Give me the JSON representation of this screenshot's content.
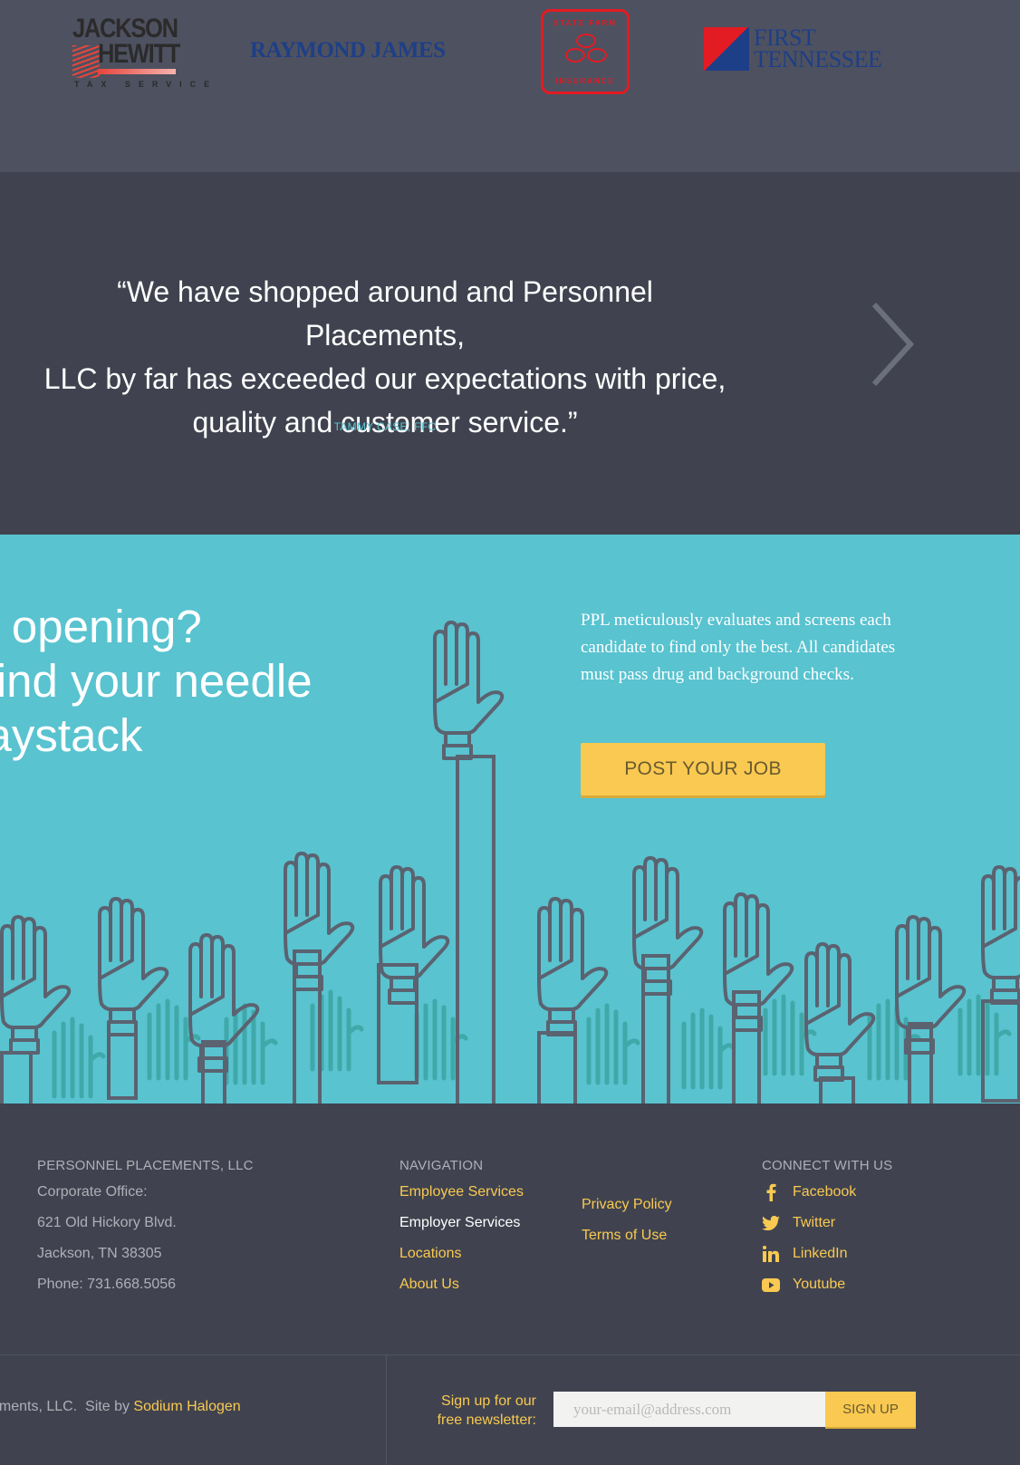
{
  "logos": {
    "jackson_hewitt": {
      "line1": "JACKSON",
      "line2": "HEWITT",
      "tagline": "TAX SERVICE"
    },
    "raymond_james": "RAYMOND JAMES",
    "state_farm": {
      "top": "STATE FARM",
      "bottom": "INSURANCE"
    },
    "first_tennessee": {
      "line1": "FIRST",
      "line2": "TENNESSEE"
    }
  },
  "testimonial": {
    "quote_lines": [
      "“We have shopped around and Personnel Placements,",
      "LLC by far has exceeded our expectations with price,",
      "quality and customer service.”"
    ],
    "author": "TAMMY CASE, FFC"
  },
  "hero": {
    "headline_lines": [
      "an opening?",
      "s find your needle",
      " haystack"
    ],
    "description": "PPL meticulously evaluates and screens each candidate to find only the best. All candidates must pass drug and background checks.",
    "cta_label": "POST YOUR JOB"
  },
  "footer": {
    "company": {
      "heading": "PERSONNEL PLACEMENTS, LLC",
      "office_label": "Corporate Office:",
      "street": "621 Old Hickory Blvd.",
      "city": "Jackson, TN 38305",
      "phone": "Phone: 731.668.5056"
    },
    "navigation": {
      "heading": "NAVIGATION",
      "col1": [
        "Employee Services",
        "Employer Services",
        "Locations",
        "About Us"
      ],
      "col2": [
        "Privacy Policy",
        "Terms of Use"
      ]
    },
    "connect": {
      "heading": "CONNECT WITH US",
      "items": [
        {
          "label": "Facebook",
          "icon": "facebook-icon"
        },
        {
          "label": "Twitter",
          "icon": "twitter-icon"
        },
        {
          "label": "LinkedIn",
          "icon": "linkedin-icon"
        },
        {
          "label": "Youtube",
          "icon": "youtube-icon"
        }
      ]
    }
  },
  "bottom": {
    "copyright": "ements, LLC.  Site by ",
    "site_by": "Sodium Halogen",
    "newsletter_label": "Sign up for our free newsletter:",
    "email_placeholder": "your-email@address.com",
    "signup_label": "SIGN UP"
  },
  "colors": {
    "accent": "#f9c951",
    "teal": "#59c3d0",
    "dark": "#40434f",
    "logo_strip": "#4e5160"
  }
}
